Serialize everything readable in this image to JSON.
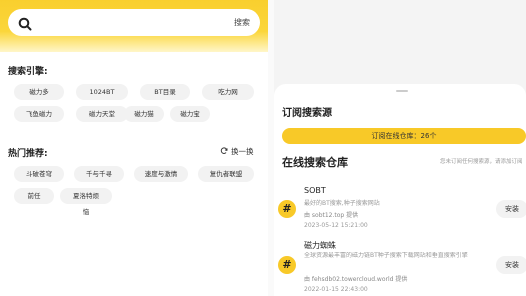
{
  "search": {
    "placeholder": "",
    "button": "搜索"
  },
  "engines": {
    "title": "搜索引擎:",
    "items": [
      "磁力多",
      "1024BT",
      "BT目录",
      "吃力网",
      "飞鱼磁力",
      "磁力天堂",
      "磁力猫",
      "磁力宝"
    ]
  },
  "hot": {
    "title": "热门推荐:",
    "refresh": "换一换",
    "items": [
      "斗破苍穹",
      "千与千寻",
      "速度与激情",
      "复仇者联盟",
      "前任",
      "夏洛特烦恼"
    ]
  },
  "sheet": {
    "title": "订阅搜索源",
    "subscribed": "订阅在线仓库：26个",
    "repo_title": "在线搜索仓库",
    "repo_note": "您未订阅任何搜索源，请添加订阅",
    "install_label": "安装",
    "items": [
      {
        "name": "SOBT",
        "desc": "最好的BT搜索,种子搜索网站",
        "source": "由 sobt12.top 提供",
        "date": "2023-05-12 15:21:00"
      },
      {
        "name": "磁力蜘蛛",
        "desc": "全球资源最丰富的磁力链BT种子搜索下载网站和垂直搜索引擎",
        "source": "由 fehsdb02.towercloud.world 提供",
        "date": "2022-01-15 22:43:00"
      }
    ]
  },
  "colors": {
    "accent": "#f8c928",
    "chip_bg": "#f2f2f2"
  },
  "icons": {
    "search": "search-icon",
    "refresh": "refresh-icon",
    "hash": "hash-icon"
  }
}
